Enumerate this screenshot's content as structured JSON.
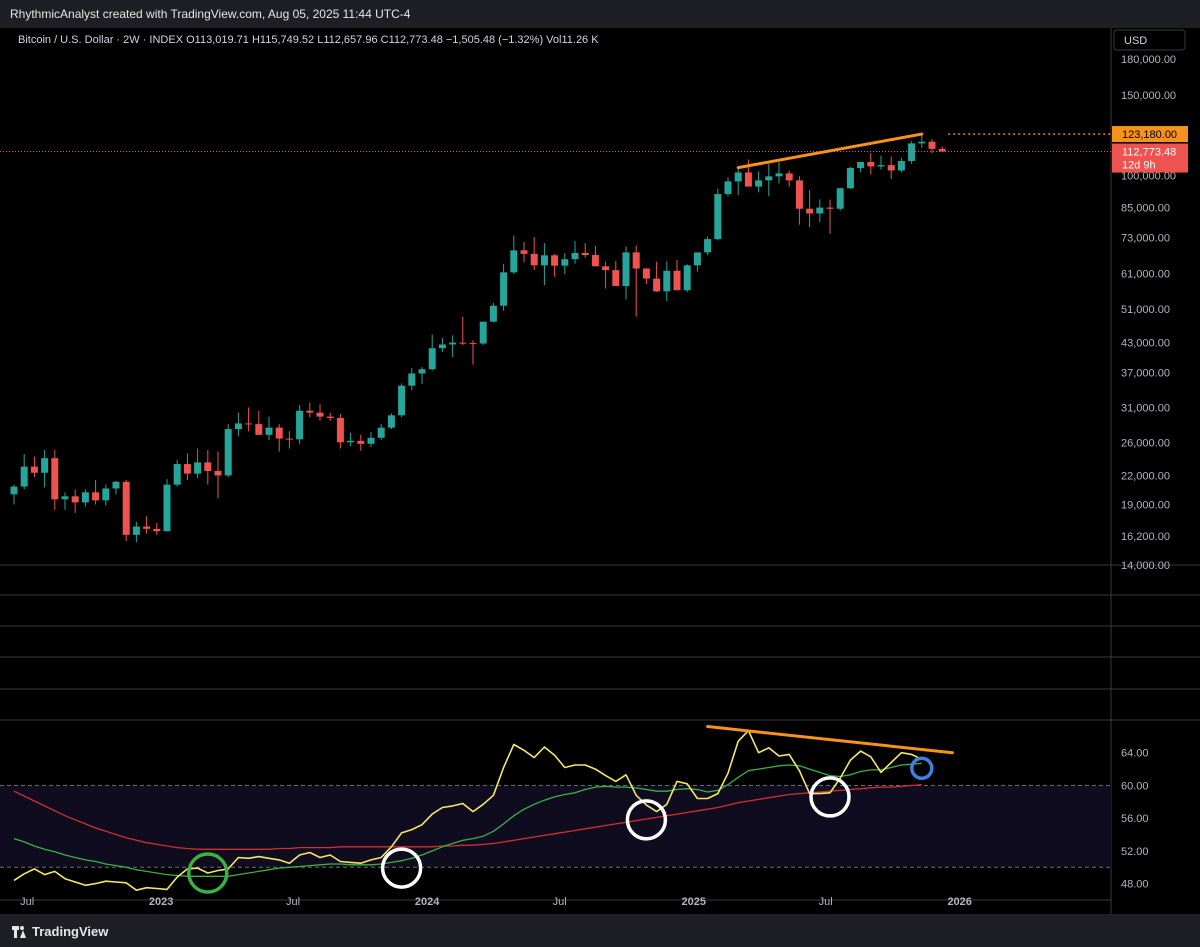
{
  "header": {
    "text": "RhythmicAnalyst created with TradingView.com, Aug 05, 2025 11:44 UTC-4"
  },
  "footer": {
    "logo_label": "TradingView",
    "logo_icon": "tradingview-logo-icon"
  },
  "legend": {
    "symbol": "Bitcoin / U.S. Dollar · 2W · INDEX",
    "o_label": "O",
    "o_value": "113,019.71",
    "h_label": "H",
    "h_value": "115,749.52",
    "l_label": "L",
    "l_value": "112,657.96",
    "c_label": "C",
    "c_value": "112,773.48",
    "change": "−1,505.48 (−1.32%)",
    "vol_label": "Vol",
    "vol_value": "11.26 K"
  },
  "currency_button": "USD",
  "colors": {
    "up": "#26a69a",
    "down": "#ef5350",
    "trendline": "#f7931a",
    "rsi": "#f5e663",
    "rsi_ma": "#3cb043",
    "long_ma": "#d32f2f",
    "circle_green": "#3cb043",
    "circle_white": "#ffffff",
    "circle_blue": "#3f7fe0"
  },
  "chart_data": {
    "type": "candlestick",
    "x_axis_labels": [
      "Jul",
      "2023",
      "Jul",
      "2024",
      "Jul",
      "2025",
      "Jul",
      "2026"
    ],
    "price_axis_ticks": [
      "180,000.00",
      "150,000.00",
      "123,180.00",
      "112,773.48",
      "100,000.00",
      "85,000.00",
      "73,000.00",
      "61,000.00",
      "51,000.00",
      "43,000.00",
      "37,000.00",
      "31,000.00",
      "26,000.00",
      "22,000.00",
      "19,000.00",
      "16,200.00",
      "14,000.00"
    ],
    "price_tick_values": [
      180000,
      150000,
      100000,
      85000,
      73000,
      61000,
      51000,
      43000,
      37000,
      31000,
      26000,
      22000,
      19000,
      16200,
      14000
    ],
    "price_scale": "log",
    "price_range": [
      14000,
      200000
    ],
    "high_label": {
      "value": 123180,
      "text": "123,180.00"
    },
    "last_price_label": {
      "value": 112773.48,
      "text": "112,773.48",
      "countdown": "12d 9h"
    },
    "start_date": "2022-06-13",
    "candles": [
      [
        20000,
        21000,
        19000,
        20800
      ],
      [
        20800,
        24500,
        20500,
        23000
      ],
      [
        23000,
        24200,
        21800,
        22300
      ],
      [
        22300,
        25000,
        20700,
        24000
      ],
      [
        24000,
        25000,
        18500,
        19500
      ],
      [
        19500,
        20200,
        18500,
        19800
      ],
      [
        19800,
        20500,
        18200,
        19200
      ],
      [
        19200,
        20500,
        18800,
        20200
      ],
      [
        20200,
        21500,
        19000,
        19400
      ],
      [
        19400,
        21000,
        18900,
        20600
      ],
      [
        20600,
        21400,
        20000,
        21300
      ],
      [
        21300,
        21500,
        15800,
        16300
      ],
      [
        16300,
        17400,
        15700,
        17000
      ],
      [
        17000,
        17900,
        16400,
        16800
      ],
      [
        16800,
        17300,
        16300,
        16600
      ],
      [
        16600,
        21600,
        16600,
        21000
      ],
      [
        21000,
        23800,
        20800,
        23300
      ],
      [
        23300,
        24600,
        21500,
        22200
      ],
      [
        22200,
        25200,
        21700,
        23500
      ],
      [
        23500,
        25000,
        21000,
        22500
      ],
      [
        22500,
        24800,
        19600,
        22000
      ],
      [
        22000,
        28500,
        21800,
        27800
      ],
      [
        27800,
        30200,
        26800,
        28600
      ],
      [
        28600,
        31000,
        27500,
        28500
      ],
      [
        28500,
        30500,
        27000,
        27000
      ],
      [
        27000,
        29600,
        26300,
        28000
      ],
      [
        28000,
        28500,
        24800,
        26500
      ],
      [
        26500,
        27500,
        25200,
        26400
      ],
      [
        26400,
        31400,
        25800,
        30500
      ],
      [
        30500,
        31800,
        29500,
        30200
      ],
      [
        30200,
        31500,
        29000,
        29600
      ],
      [
        29600,
        30200,
        29000,
        29400
      ],
      [
        29400,
        30000,
        25200,
        26000
      ],
      [
        26000,
        27300,
        25500,
        26200
      ],
      [
        26200,
        27000,
        24900,
        25800
      ],
      [
        25800,
        27400,
        25400,
        26600
      ],
      [
        26600,
        28500,
        26300,
        28000
      ],
      [
        28000,
        30100,
        27800,
        29800
      ],
      [
        29800,
        35000,
        29500,
        34600
      ],
      [
        34600,
        37800,
        33800,
        36800
      ],
      [
        36800,
        38000,
        34900,
        37600
      ],
      [
        37600,
        44800,
        37300,
        41800
      ],
      [
        41800,
        44000,
        41000,
        42600
      ],
      [
        42600,
        44600,
        40000,
        43000
      ],
      [
        43000,
        49000,
        42500,
        42900
      ],
      [
        42900,
        43500,
        38500,
        42800
      ],
      [
        42800,
        47000,
        42500,
        47800
      ],
      [
        47800,
        52500,
        47600,
        51800
      ],
      [
        51800,
        64000,
        50500,
        61300
      ],
      [
        61300,
        73800,
        60800,
        68500
      ],
      [
        68500,
        71500,
        64500,
        67300
      ],
      [
        67300,
        73200,
        62000,
        63500
      ],
      [
        63500,
        71000,
        57500,
        66800
      ],
      [
        66800,
        67200,
        60000,
        63400
      ],
      [
        63400,
        67500,
        60700,
        65500
      ],
      [
        65500,
        71900,
        64000,
        67600
      ],
      [
        67600,
        71000,
        66000,
        66900
      ],
      [
        66900,
        70000,
        64000,
        63200
      ],
      [
        63200,
        64700,
        56500,
        62000
      ],
      [
        62000,
        64900,
        59000,
        57200
      ],
      [
        57200,
        69900,
        53500,
        67800
      ],
      [
        67800,
        70200,
        49000,
        62500
      ],
      [
        62500,
        62600,
        57800,
        59400
      ],
      [
        59400,
        64700,
        55500,
        55700
      ],
      [
        55700,
        64800,
        53000,
        61800
      ],
      [
        61800,
        65300,
        57500,
        56000
      ],
      [
        56000,
        63900,
        55500,
        63500
      ],
      [
        63500,
        66500,
        61500,
        67800
      ],
      [
        67800,
        73500,
        66800,
        72500
      ],
      [
        72500,
        93500,
        72000,
        91000
      ],
      [
        91000,
        99000,
        90000,
        97000
      ],
      [
        97000,
        104000,
        90500,
        101500
      ],
      [
        101500,
        108300,
        95000,
        94500
      ],
      [
        94500,
        102000,
        91800,
        97500
      ],
      [
        97500,
        106000,
        90000,
        99500
      ],
      [
        99500,
        107000,
        96000,
        101000
      ],
      [
        101000,
        102500,
        94500,
        97500
      ],
      [
        97500,
        99500,
        78000,
        84500
      ],
      [
        84500,
        92800,
        77000,
        82500
      ],
      [
        82500,
        88600,
        79000,
        85000
      ],
      [
        85000,
        88500,
        74500,
        84500
      ],
      [
        84500,
        94000,
        83700,
        93700
      ],
      [
        93700,
        104300,
        93400,
        103800
      ],
      [
        103800,
        105000,
        101500,
        107000
      ],
      [
        107000,
        111800,
        100400,
        104600
      ],
      [
        104600,
        110500,
        103000,
        105300
      ],
      [
        105300,
        110000,
        98200,
        102500
      ],
      [
        102500,
        109200,
        101500,
        107500
      ],
      [
        107500,
        118800,
        106000,
        117500
      ],
      [
        117500,
        123180,
        115000,
        118500
      ],
      [
        118500,
        120000,
        111900,
        114300
      ],
      [
        114300,
        115750,
        112658,
        112773
      ]
    ],
    "price_trendline": {
      "start_index": 71,
      "start_value": 104000,
      "end_index": 89,
      "end_value": 123180
    },
    "rsi": {
      "levels": [
        64,
        60,
        56,
        52,
        48
      ],
      "range": [
        46,
        68
      ],
      "band": [
        50,
        60
      ],
      "rsi_values": [
        48.4,
        49.2,
        49.8,
        49.1,
        49.5,
        48.6,
        48.2,
        47.8,
        48.0,
        48.3,
        48.2,
        48.1,
        47.2,
        47.5,
        47.4,
        47.3,
        48.8,
        49.8,
        49.9,
        49.3,
        49.6,
        49.8,
        51.2,
        51.1,
        51.3,
        51.1,
        50.9,
        50.5,
        51.5,
        51.8,
        51.2,
        51.5,
        50.7,
        50.6,
        50.5,
        50.9,
        51.2,
        52.5,
        54.2,
        54.6,
        55.2,
        56.5,
        57.3,
        57.5,
        57.8,
        56.8,
        57.7,
        58.8,
        62.2,
        65.0,
        64.3,
        63.4,
        64.7,
        63.7,
        62.2,
        62.5,
        62.5,
        62.0,
        61.2,
        60.5,
        61.3,
        58.8,
        57.6,
        56.8,
        57.7,
        60.5,
        60.2,
        58.4,
        58.4,
        59.0,
        61.5,
        65.4,
        66.7,
        64.0,
        64.6,
        63.6,
        63.8,
        61.8,
        59.0,
        59.0,
        59.1,
        60.9,
        63.1,
        64.2,
        63.5,
        61.6,
        62.8,
        64.0,
        63.8,
        63.2
      ],
      "rsi_ma_values": [
        53.5,
        53.1,
        52.6,
        52.2,
        51.9,
        51.5,
        51.2,
        50.9,
        50.7,
        50.4,
        50.2,
        50.0,
        49.7,
        49.5,
        49.3,
        49.1,
        49.0,
        48.9,
        48.9,
        48.9,
        48.9,
        48.9,
        49.1,
        49.3,
        49.5,
        49.7,
        49.9,
        50.0,
        50.1,
        50.2,
        50.3,
        50.4,
        50.4,
        50.3,
        50.3,
        50.3,
        50.4,
        50.6,
        50.8,
        51.1,
        51.5,
        52.0,
        52.5,
        52.9,
        53.3,
        53.5,
        53.8,
        54.4,
        55.3,
        56.3,
        57.1,
        57.7,
        58.2,
        58.6,
        58.9,
        59.1,
        59.5,
        59.8,
        59.9,
        59.8,
        59.8,
        59.7,
        59.5,
        59.3,
        59.3,
        59.5,
        59.6,
        59.5,
        59.2,
        59.4,
        60.1,
        61.0,
        61.8,
        62.0,
        62.2,
        62.4,
        62.5,
        62.4,
        62.0,
        61.6,
        61.2,
        61.1,
        61.3,
        61.7,
        61.9,
        61.9,
        62.2,
        62.5,
        62.6,
        62.7
      ],
      "long_ma_values": [
        59.3,
        58.7,
        58.1,
        57.5,
        56.9,
        56.3,
        55.8,
        55.3,
        54.8,
        54.4,
        54.0,
        53.6,
        53.3,
        53.0,
        52.8,
        52.6,
        52.4,
        52.3,
        52.2,
        52.2,
        52.2,
        52.2,
        52.2,
        52.2,
        52.2,
        52.2,
        52.3,
        52.3,
        52.4,
        52.4,
        52.4,
        52.4,
        52.5,
        52.5,
        52.5,
        52.5,
        52.5,
        52.5,
        52.5,
        52.5,
        52.5,
        52.5,
        52.6,
        52.6,
        52.7,
        52.7,
        52.8,
        52.9,
        53.1,
        53.3,
        53.5,
        53.7,
        53.9,
        54.1,
        54.3,
        54.5,
        54.7,
        54.9,
        55.1,
        55.3,
        55.5,
        55.7,
        55.9,
        56.1,
        56.3,
        56.5,
        56.7,
        56.9,
        57.1,
        57.3,
        57.6,
        57.9,
        58.1,
        58.3,
        58.5,
        58.7,
        58.9,
        59.0,
        59.1,
        59.2,
        59.3,
        59.4,
        59.5,
        59.6,
        59.7,
        59.8,
        59.8,
        59.9,
        60.0,
        60.1
      ],
      "rsi_trendline": {
        "start_index": 68,
        "start_value": 67.2,
        "end_index": 92,
        "end_value": 64.0
      },
      "circles": [
        {
          "index": 19,
          "value": 49.3,
          "color": "green"
        },
        {
          "index": 38,
          "value": 49.9,
          "color": "white"
        },
        {
          "index": 62,
          "value": 55.8,
          "color": "white"
        },
        {
          "index": 80,
          "value": 58.6,
          "color": "white"
        },
        {
          "index": 89,
          "value": 62.1,
          "color": "blue"
        }
      ]
    }
  }
}
